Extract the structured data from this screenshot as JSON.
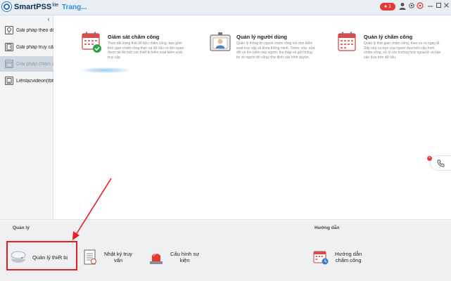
{
  "titlebar": {
    "app_name": "SmartPSS",
    "app_suffix": "lite",
    "home_tab": "Trang...",
    "rec_badge": "1",
    "icons": [
      "user-icon",
      "gear-icon",
      "settings-icon",
      "minimize-icon",
      "maximize-icon",
      "close-icon"
    ]
  },
  "sidebar": {
    "collapse_glyph": "‹",
    "items": [
      {
        "label": "Giải pháp theo dõi",
        "icon": "monitor-icon",
        "active": false
      },
      {
        "label": "Giải pháp truy cập",
        "icon": "door-icon",
        "active": false
      },
      {
        "label": "Giải pháp chấm c...",
        "icon": "attendance-icon",
        "active": true
      },
      {
        "label": "Liênlạcvideon(tbt)",
        "icon": "video-call-icon",
        "active": false
      }
    ]
  },
  "cards": [
    {
      "title": "Giám sát chấm công",
      "description": "Theo dõi trạng thái đổ liệu chấm công, bao gồm thời gian chấm công thực và dữ liệu có liên quan được tải lên bởi các thiết bị kiểm soát kiểm soát truy cập.",
      "icon": "calendar-check-icon"
    },
    {
      "title": "Quản lý người dùng",
      "description": "Quản lý thông tin người chấm công mô đun kiểm soát truy cập và khóa thông minh. Thêm, xóa, sửa đổi và tìm kiếm mọi người, thu thập và gửi thông tin về người đó cũng như định cấu hình quyền.",
      "icon": "id-card-icon"
    },
    {
      "title": "Quản lý chấm công",
      "description": "Quản lý thời gian chấm công, theo ca và ngày lễ. Sắp xếp ca trực của người dựa trên cấu hình chấm công, xử lý các trường hợp ngoại lệ và báo cáo dựa trên dữ liệu.",
      "icon": "calendar-icon"
    }
  ],
  "bottom": {
    "manage_label": "Quản lý",
    "guide_label": "Hướng dẫn",
    "tools": [
      {
        "label": "Quản lý thiết bị",
        "icon": "device-manager-icon"
      },
      {
        "label": "Nhật ký truy\nvấn",
        "icon": "log-icon"
      },
      {
        "label": "Cấu hình sự\nkiện",
        "icon": "alarm-light-icon"
      },
      {
        "label": "Hướng dẫn\nchấm công",
        "icon": "attendance-guide-icon"
      }
    ]
  },
  "colors": {
    "accent": "#2f8fd8",
    "highlight": "#e32020",
    "active_nav": "#cfd6dd"
  }
}
